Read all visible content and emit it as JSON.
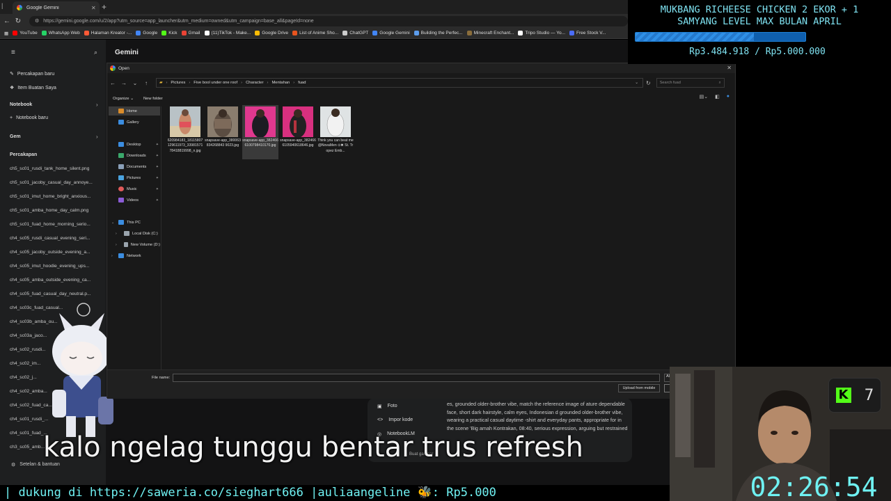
{
  "browser": {
    "tab_title": "Google Gemini",
    "url": "https://gemini.google.com/u/2/app?utm_source=app_launcher&utm_medium=owned&utm_campaign=base_all&pageId=none",
    "bookmarks": [
      {
        "label": "YouTube",
        "color": "#ff0000"
      },
      {
        "label": "WhatsApp Web",
        "color": "#25d366"
      },
      {
        "label": "Halaman Kreator -...",
        "color": "#ff5a36"
      },
      {
        "label": "Google",
        "color": "#4285f4"
      },
      {
        "label": "Kick",
        "color": "#53fc18"
      },
      {
        "label": "Gmail",
        "color": "#ea4335"
      },
      {
        "label": "(11)TikTok - Make...",
        "color": "#ffffff"
      },
      {
        "label": "Google Drive",
        "color": "#fbbc05"
      },
      {
        "label": "List of Anime Sho...",
        "color": "#e8541e"
      },
      {
        "label": "ChatGPT",
        "color": "#cccccc"
      },
      {
        "label": "Google Gemini",
        "color": "#4285f4"
      },
      {
        "label": "Building the Perfec...",
        "color": "#5c9ded"
      },
      {
        "label": "Minecraft Enchant...",
        "color": "#8a6d3b"
      },
      {
        "label": "Tripo Studio — Yo...",
        "color": "#ffffff"
      },
      {
        "label": "Free Stock V...",
        "color": "#4a6cf7"
      }
    ]
  },
  "gemini": {
    "title": "Gemini",
    "new_chat": "Percakapan baru",
    "my_items": "Item Buatan Saya",
    "notebook_section": "Notebook",
    "new_notebook": "Notebook baru",
    "gem_section": "Gem",
    "chats_section": "Percakapan",
    "recent": [
      "ch5_sc01_rusdi_tank_home_silent.png",
      "ch5_sc01_jacoby_casual_day_annoye...",
      "ch5_sc01_imut_home_bright_anxious...",
      "ch5_sc01_amba_home_day_calm.png",
      "ch5_sc01_fuad_home_morning_serio...",
      "ch4_sc05_rusdi_casual_evening_seri...",
      "ch4_sc05_jacoby_outside_evening_a...",
      "ch4_sc05_imut_hoodie_evening_ups...",
      "ch4_sc05_amba_outside_evening_ca...",
      "ch4_sc05_fuad_casual_day_neutral.p...",
      "ch4_sc03c_fuad_casual...",
      "ch4_sc03b_amba_ou...",
      "ch4_sc03a_jaco...",
      "ch4_sc02_rusdi...",
      "ch4_sc02_im...",
      "ch4_sc02_j...",
      "ch4_sc02_amba...",
      "ch4_sc02_fuad_ca...",
      "ch4_sc01_rusdi_...",
      "ch4_sc01_fuad_...",
      "ch3_sc05_amb..."
    ],
    "settings": "Setelan & bantuan",
    "upload_menu": {
      "items": [
        "Foto",
        "Impor kode",
        "NotebookLM"
      ],
      "prompt_text": "es, grounded older-brother vibe, match the reference image of ature dependable face, short dark hairstyle, calm eyes, Indonesian d grounded older-brother vibe, wearing a practical casual daytime -shirt and everyday pants, appropriate for in the scene 'Big amah Kontrakan, 08:40, serious expression, arguing but restrained",
      "partial_label": "Buat gambar"
    }
  },
  "dialog": {
    "title": "Open",
    "breadcrumb": [
      "Pictures",
      "Five bool under one roof",
      "Character",
      "Mentahan",
      "fuad"
    ],
    "search_placeholder": "Search fuad",
    "organize": "Organize",
    "new_folder": "New folder",
    "nav": {
      "home": "Home",
      "gallery": "Gallery",
      "desktop": "Desktop",
      "downloads": "Downloads",
      "documents": "Documents",
      "pictures": "Pictures",
      "music": "Music",
      "videos": "Videos",
      "this_pc": "This PC",
      "local_disk": "Local Disk (C:)",
      "new_volume": "New Volume (D:)",
      "network": "Network"
    },
    "files": [
      "620984183_18115807129611973_3398157178418819998_n.jpg",
      "snapsave-app_380063834268843 9023.jpg",
      "snapsave-app_3824666100798410170.jpg",
      "snapsave-app_3824666105940618646.jpg",
      "Think you can beat me @NovaMen ⊙✖ St. Tropez Emb..."
    ],
    "file_name_label": "File name:",
    "file_name_value": "",
    "file_type": "All",
    "upload_mobile": "Upload from mobile"
  },
  "overlay": {
    "goal_title": "MUKBANG RICHEESE CHICKEN 2 EKOR + 1\nSAMYANG LEVEL MAX BULAN APRIL",
    "goal_amount": "Rp3.484.918 / Rp5.000.000",
    "goal_progress": 0.697,
    "kick_count": "7",
    "clock": "02:26:54",
    "caption": "kalo ngelag tunggu bentar trus refresh",
    "ticker": "| dukung di https://saweria.co/sieghart666 |auliaangeline 🐝: Rp5.000"
  }
}
